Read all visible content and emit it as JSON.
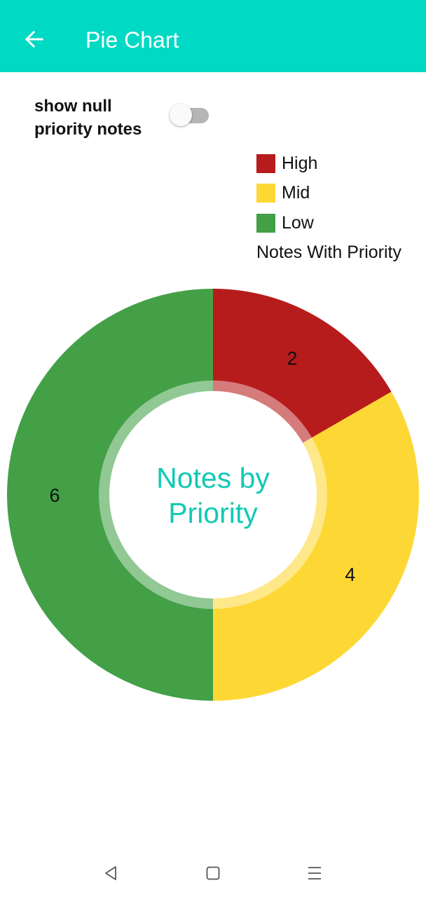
{
  "app_bar": {
    "title": "Pie Chart",
    "back_icon": "arrow-left-icon",
    "background_color": "#00d9c4"
  },
  "settings": {
    "toggle_label": "show null priority notes",
    "toggle_on": false
  },
  "chart_data": {
    "type": "pie",
    "style": "donut",
    "categories": [
      "High",
      "Mid",
      "Low"
    ],
    "values": [
      2,
      4,
      6
    ],
    "colors": [
      "#b71c1c",
      "#fdd835",
      "#43a047"
    ],
    "center_text": "Notes by Priority",
    "center_text_color": "#12c9b5",
    "legend_title": "Notes With Priority",
    "legend_position": "top-right",
    "start_angle": "top",
    "direction": "clockwise"
  },
  "nav_bar": {
    "back_icon": "triangle-back-icon",
    "home_icon": "square-home-icon",
    "menu_icon": "menu-lines-icon"
  }
}
